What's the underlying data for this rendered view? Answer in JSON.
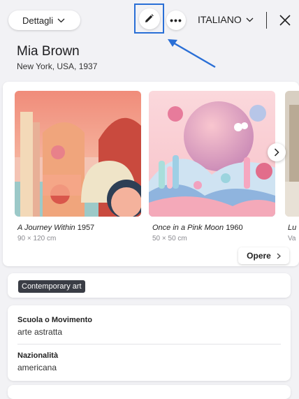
{
  "header": {
    "details_label": "Dettagli",
    "language_label": "ITALIANO",
    "more_label": "•••"
  },
  "artist": {
    "name": "Mia Brown",
    "subtitle": "New York, USA, 1937"
  },
  "artworks": [
    {
      "title": "A Journey Within",
      "year": "1957",
      "size": "90 × 120 cm"
    },
    {
      "title": "Once in a Pink Moon",
      "year": "1960",
      "size": "50 × 50 cm"
    },
    {
      "title": "Lu",
      "year": "",
      "size": "Va"
    }
  ],
  "works_button_label": "Opere",
  "tag": "Contemporary art",
  "info": {
    "movement_label": "Scuola o Movimento",
    "movement_value": "arte astratta",
    "nationality_label": "Nazionalità",
    "nationality_value": "americana"
  },
  "colors": {
    "highlight": "#2a6fd6",
    "tag_bg": "#3a3d45"
  }
}
